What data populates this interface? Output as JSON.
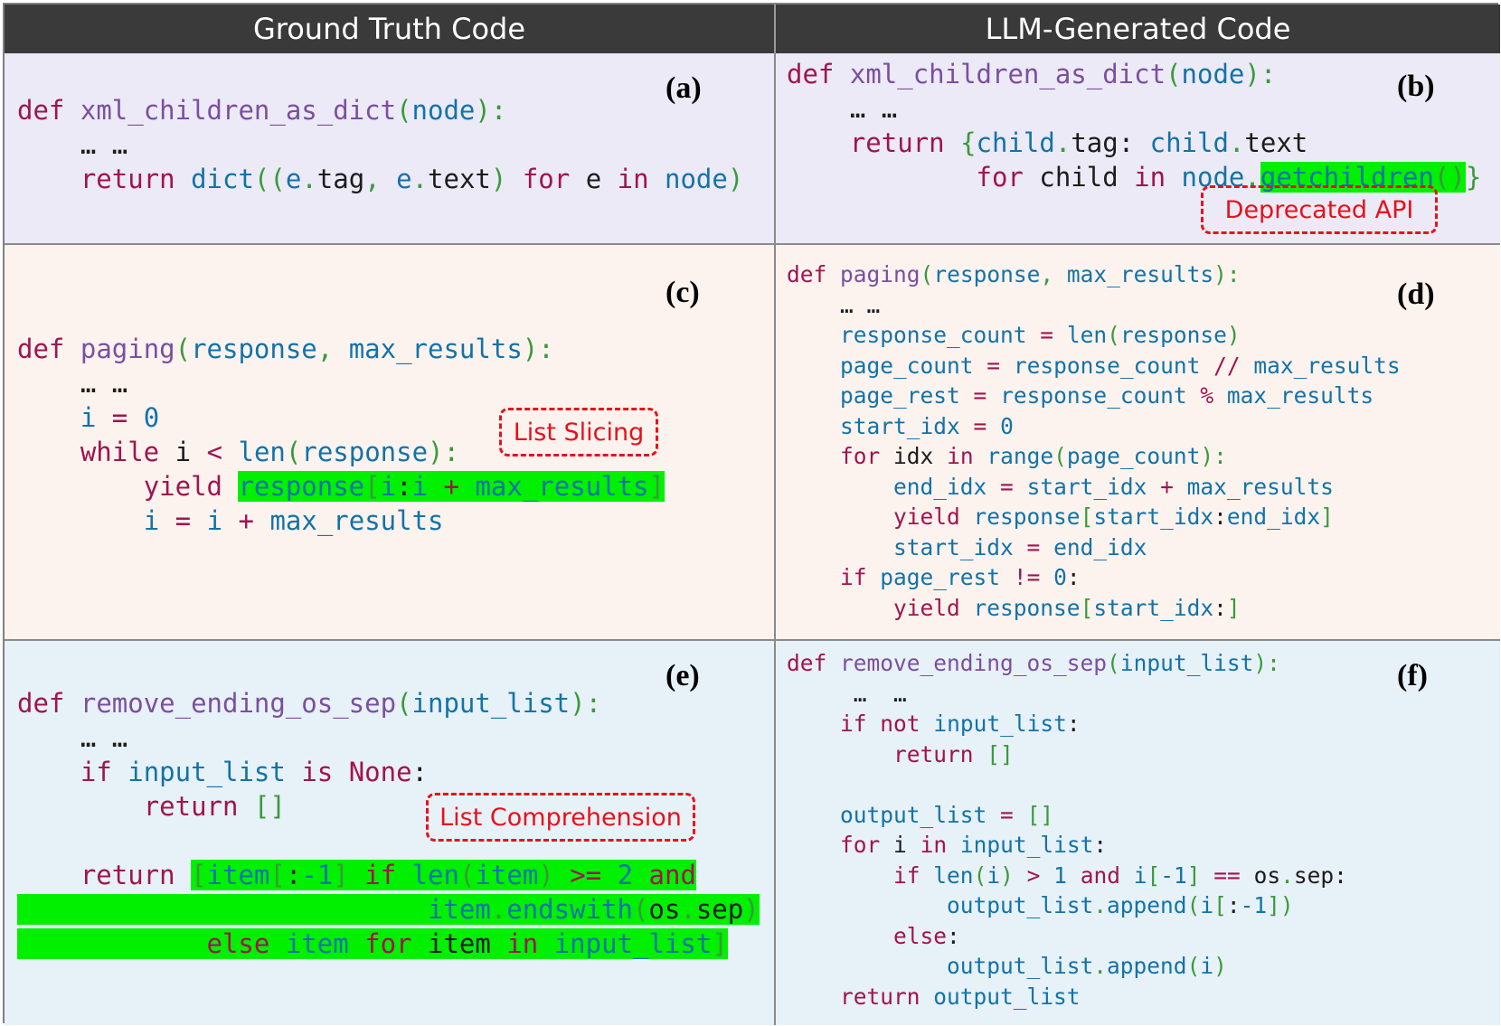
{
  "headers": {
    "left": "Ground Truth Code",
    "right": "LLM-Generated Code"
  },
  "panels": {
    "a": {
      "label": "(a)",
      "def": "def",
      "fname": "xml_children_as_dict",
      "param": "node",
      "ellipsis": "… …",
      "return_kw": "return",
      "dict": "dict",
      "e": "e",
      "tag": "tag",
      "text": "text",
      "for_kw": "for",
      "in_kw": "in",
      "node": "node"
    },
    "b": {
      "label": "(b)",
      "def": "def",
      "fname": "xml_children_as_dict",
      "param": "node",
      "ellipsis": "… …",
      "return_kw": "return",
      "child": "child",
      "tag": "tag",
      "text": "text",
      "for_kw": "for",
      "in_kw": "in",
      "node": "node",
      "method": "getchildren",
      "callout": "Deprecated API"
    },
    "c": {
      "label": "(c)",
      "def": "def",
      "fname": "paging",
      "p1": "response",
      "p2": "max_results",
      "ellipsis": "… …",
      "i": "i",
      "zero": "0",
      "while_kw": "while",
      "len": "len",
      "yield_kw": "yield",
      "callout": "List Slicing"
    },
    "d": {
      "label": "(d)",
      "def": "def",
      "fname": "paging",
      "p1": "response",
      "p2": "max_results",
      "ellipsis": "… …",
      "response_count": "response_count",
      "page_count": "page_count",
      "page_rest": "page_rest",
      "start_idx": "start_idx",
      "end_idx": "end_idx",
      "idx": "idx",
      "len": "len",
      "range": "range",
      "for_kw": "for",
      "in_kw": "in",
      "if_kw": "if",
      "yield_kw": "yield",
      "zero": "0"
    },
    "e": {
      "label": "(e)",
      "def": "def",
      "fname": "remove_ending_os_sep",
      "param": "input_list",
      "ellipsis": "… …",
      "if_kw": "if",
      "is_kw": "is",
      "none_kw": "None",
      "return_kw": "return",
      "item": "item",
      "len": "len",
      "two": "2",
      "neg1": "-1",
      "and_kw": "and",
      "endswith": "endswith",
      "os": "os",
      "sep": "sep",
      "else_kw": "else",
      "for_kw": "for",
      "in_kw": "in",
      "callout": "List Comprehension"
    },
    "f": {
      "label": "(f)",
      "def": "def",
      "fname": "remove_ending_os_sep",
      "param": "input_list",
      "ellipsis": "…  …",
      "if_kw": "if",
      "not_kw": "not",
      "return_kw": "return",
      "output_list": "output_list",
      "for_kw": "for",
      "in_kw": "in",
      "i": "i",
      "len": "len",
      "one": "1",
      "and_kw": "and",
      "neg1": "-1",
      "os": "os",
      "sep": "sep",
      "append": "append",
      "else_kw": "else"
    }
  }
}
